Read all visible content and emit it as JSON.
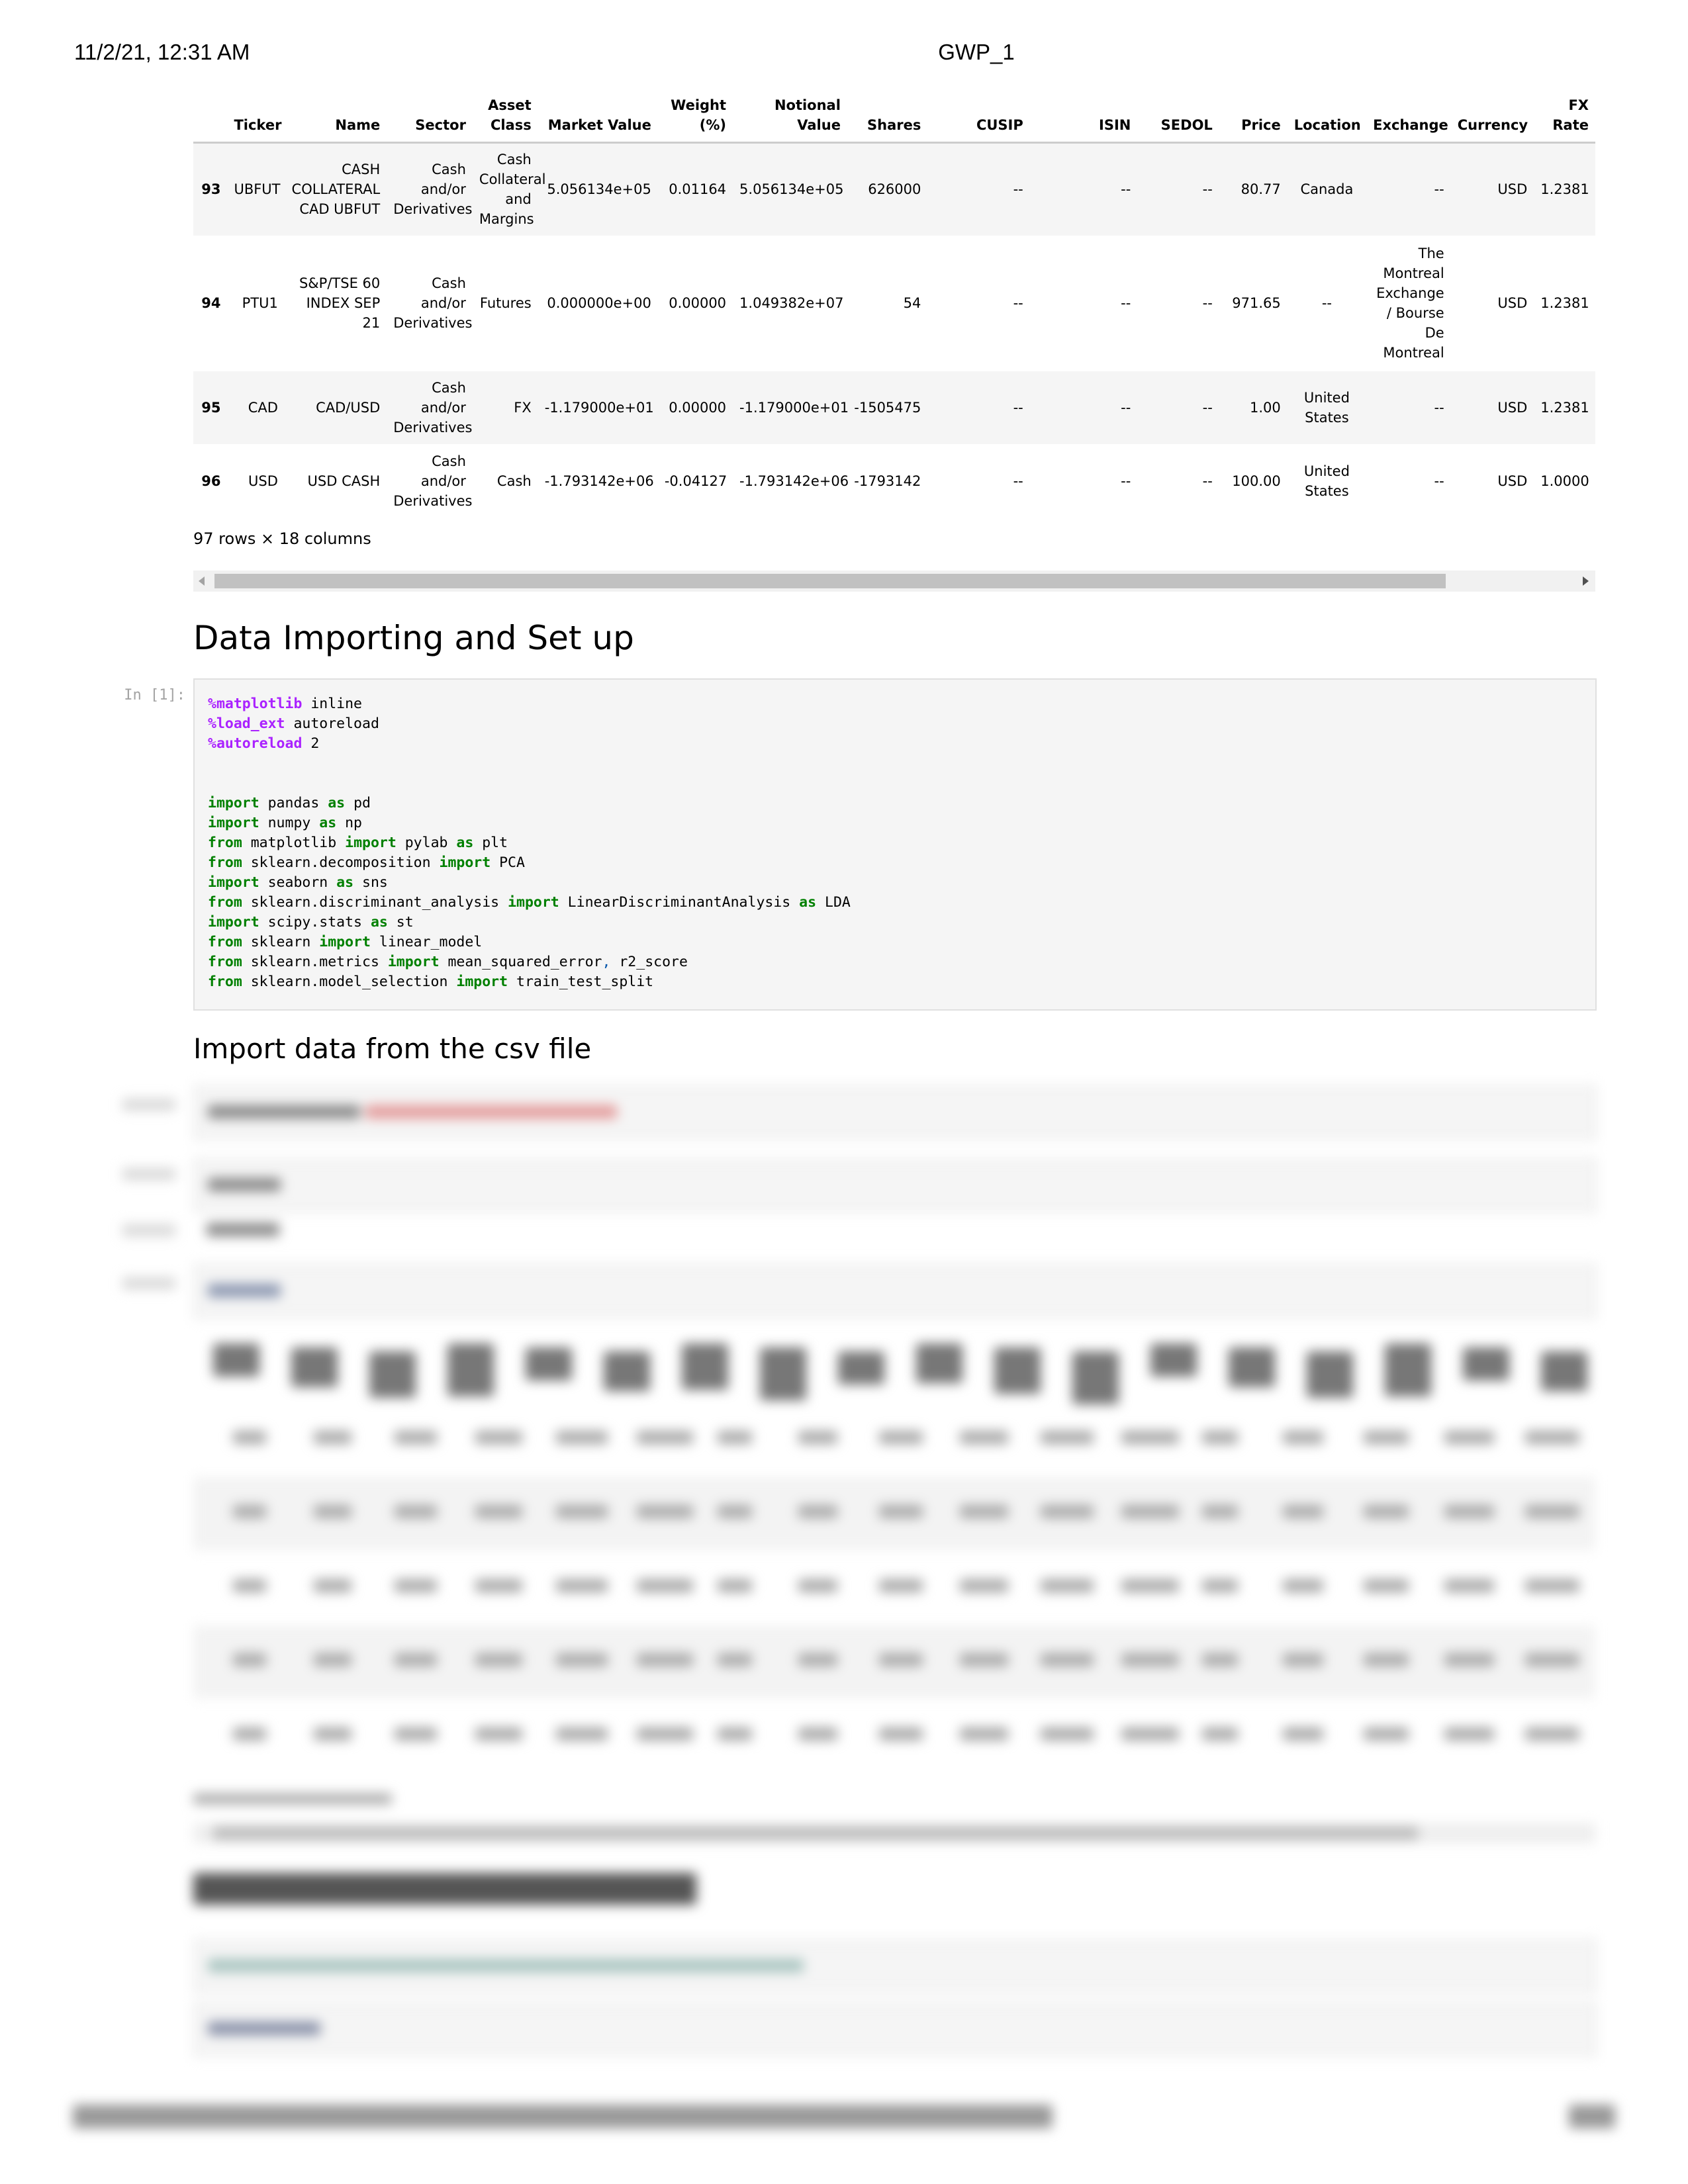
{
  "print_header": {
    "datetime": "11/2/21, 12:31 AM",
    "title": "GWP_1"
  },
  "dataframe": {
    "columns": [
      "",
      "Ticker",
      "Name",
      "Sector",
      "Asset Class",
      "Market Value",
      "Weight (%)",
      "Notional Value",
      "Shares",
      "CUSIP",
      "ISIN",
      "SEDOL",
      "Price",
      "Location",
      "Exchange",
      "Currency",
      "FX Rate"
    ],
    "rows": [
      {
        "index": "93",
        "Ticker": "UBFUT",
        "Name": "CASH COLLATERAL CAD UBFUT",
        "Sector": "Cash and/or Derivatives",
        "Asset Class": "Cash Collateral and Margins",
        "Market Value": "5.056134e+05",
        "Weight (%)": "0.01164",
        "Notional Value": "5.056134e+05",
        "Shares": "626000",
        "CUSIP": "--",
        "ISIN": "--",
        "SEDOL": "--",
        "Price": "80.77",
        "Location": "Canada",
        "Exchange": "--",
        "Currency": "USD",
        "FX Rate": "1.2381"
      },
      {
        "index": "94",
        "Ticker": "PTU1",
        "Name": "S&P/TSE 60 INDEX SEP 21",
        "Sector": "Cash and/or Derivatives",
        "Asset Class": "Futures",
        "Market Value": "0.000000e+00",
        "Weight (%)": "0.00000",
        "Notional Value": "1.049382e+07",
        "Shares": "54",
        "CUSIP": "--",
        "ISIN": "--",
        "SEDOL": "--",
        "Price": "971.65",
        "Location": "--",
        "Exchange": "The Montreal Exchange / Bourse De Montreal",
        "Currency": "USD",
        "FX Rate": "1.2381"
      },
      {
        "index": "95",
        "Ticker": "CAD",
        "Name": "CAD/USD",
        "Sector": "Cash and/or Derivatives",
        "Asset Class": "FX",
        "Market Value": "-1.179000e+01",
        "Weight (%)": "0.00000",
        "Notional Value": "-1.179000e+01",
        "Shares": "-1505475",
        "CUSIP": "--",
        "ISIN": "--",
        "SEDOL": "--",
        "Price": "1.00",
        "Location": "United States",
        "Exchange": "--",
        "Currency": "USD",
        "FX Rate": "1.2381"
      },
      {
        "index": "96",
        "Ticker": "USD",
        "Name": "USD CASH",
        "Sector": "Cash and/or Derivatives",
        "Asset Class": "Cash",
        "Market Value": "-1.793142e+06",
        "Weight (%)": "-0.04127",
        "Notional Value": "-1.793142e+06",
        "Shares": "-1793142",
        "CUSIP": "--",
        "ISIN": "--",
        "SEDOL": "--",
        "Price": "100.00",
        "Location": "United States",
        "Exchange": "--",
        "Currency": "USD",
        "FX Rate": "1.0000"
      }
    ],
    "shape_note": "97 rows × 18 columns"
  },
  "sections": {
    "data_importing": "Data Importing and Set up",
    "import_csv": "Import data from the csv file"
  },
  "code_cell_1": {
    "prompt": "In [1]:",
    "lines": [
      [
        {
          "t": "%matplotlib",
          "c": "mg"
        },
        {
          "t": " inline"
        }
      ],
      [
        {
          "t": "%load_ext",
          "c": "mg"
        },
        {
          "t": " autoreload"
        }
      ],
      [
        {
          "t": "%autoreload",
          "c": "mg"
        },
        {
          "t": " 2"
        }
      ],
      [],
      [],
      [
        {
          "t": "import",
          "c": "kw"
        },
        {
          "t": " pandas "
        },
        {
          "t": "as",
          "c": "kw"
        },
        {
          "t": " pd"
        }
      ],
      [
        {
          "t": "import",
          "c": "kw"
        },
        {
          "t": " numpy "
        },
        {
          "t": "as",
          "c": "kw"
        },
        {
          "t": " np"
        }
      ],
      [
        {
          "t": "from",
          "c": "kw"
        },
        {
          "t": " matplotlib "
        },
        {
          "t": "import",
          "c": "kw"
        },
        {
          "t": " pylab "
        },
        {
          "t": "as",
          "c": "kw"
        },
        {
          "t": " plt"
        }
      ],
      [
        {
          "t": "from",
          "c": "kw"
        },
        {
          "t": " sklearn.decomposition "
        },
        {
          "t": "import",
          "c": "kw"
        },
        {
          "t": " PCA"
        }
      ],
      [
        {
          "t": "import",
          "c": "kw"
        },
        {
          "t": " seaborn "
        },
        {
          "t": "as",
          "c": "kw"
        },
        {
          "t": " sns"
        }
      ],
      [
        {
          "t": "from",
          "c": "kw"
        },
        {
          "t": " sklearn.discriminant_analysis "
        },
        {
          "t": "import",
          "c": "kw"
        },
        {
          "t": " LinearDiscriminantAnalysis "
        },
        {
          "t": "as",
          "c": "kw"
        },
        {
          "t": " LDA"
        }
      ],
      [
        {
          "t": "import",
          "c": "kw"
        },
        {
          "t": " scipy.stats "
        },
        {
          "t": "as",
          "c": "kw"
        },
        {
          "t": " st"
        }
      ],
      [
        {
          "t": "from",
          "c": "kw"
        },
        {
          "t": " sklearn "
        },
        {
          "t": "import",
          "c": "kw"
        },
        {
          "t": " linear_model"
        }
      ],
      [
        {
          "t": "from",
          "c": "kw"
        },
        {
          "t": " sklearn.metrics "
        },
        {
          "t": "import",
          "c": "kw"
        },
        {
          "t": " mean_squared_error"
        },
        {
          "t": ",",
          "c": "pn"
        },
        {
          "t": " r2_score"
        }
      ],
      [
        {
          "t": "from",
          "c": "kw"
        },
        {
          "t": " sklearn.model_selection "
        },
        {
          "t": "import",
          "c": "kw"
        },
        {
          "t": " train_test_split"
        }
      ]
    ]
  },
  "blurred_section": {
    "heading": "1-Dimensional Data Summaries"
  }
}
